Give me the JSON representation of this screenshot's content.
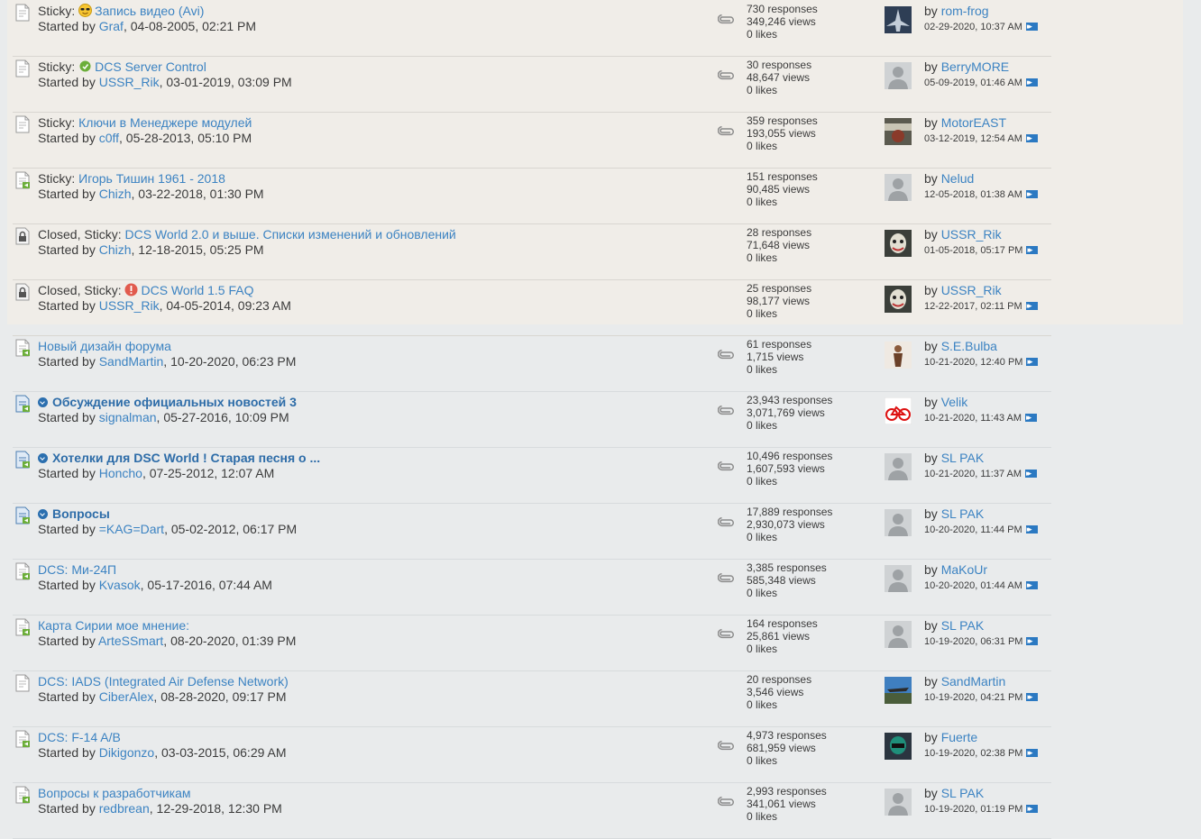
{
  "labels": {
    "started_by": "Started by",
    "by": "by",
    "responses": "responses",
    "views": "views",
    "likes": "likes"
  },
  "topics": [
    {
      "prefix": "Sticky:",
      "emoji": "cool",
      "title": "Запись видео (Avi)",
      "bold": false,
      "author": "Graf",
      "started": "04-08-2005, 02:21 PM",
      "responses": "730",
      "views": "349,246",
      "likes": "0",
      "attach": true,
      "last_user": "rom-frog",
      "last_date": "02-29-2020, 10:37 AM",
      "avatar": "jet",
      "icon": "doc"
    },
    {
      "prefix": "Sticky:",
      "emoji": "green",
      "title": "DCS Server Control",
      "bold": false,
      "author": "USSR_Rik",
      "started": "03-01-2019, 03:09 PM",
      "responses": "30",
      "views": "48,647",
      "likes": "0",
      "attach": true,
      "last_user": "BerryMORE",
      "last_date": "05-09-2019, 01:46 AM",
      "avatar": "default",
      "icon": "doc"
    },
    {
      "prefix": "Sticky:",
      "emoji": "",
      "title": "Ключи в Менеджере модулей",
      "bold": false,
      "author": "c0ff",
      "started": "05-28-2013, 05:10 PM",
      "responses": "359",
      "views": "193,055",
      "likes": "0",
      "attach": true,
      "last_user": "MotorEAST",
      "last_date": "03-12-2019, 12:54 AM",
      "avatar": "photo",
      "icon": "doc"
    },
    {
      "prefix": "Sticky:",
      "emoji": "",
      "title": "Игорь Тишин 1961 - 2018",
      "bold": false,
      "author": "Chizh",
      "started": "03-22-2018, 01:30 PM",
      "responses": "151",
      "views": "90,485",
      "likes": "0",
      "attach": false,
      "last_user": "Nelud",
      "last_date": "12-05-2018, 01:38 AM",
      "avatar": "default",
      "icon": "doc-new"
    },
    {
      "prefix": "Closed, Sticky:",
      "emoji": "",
      "title": "DCS World 2.0 и выше. Списки изменений и обновлений",
      "bold": false,
      "author": "Chizh",
      "started": "12-18-2015, 05:25 PM",
      "responses": "28",
      "views": "71,648",
      "likes": "0",
      "attach": false,
      "last_user": "USSR_Rik",
      "last_date": "01-05-2018, 05:17 PM",
      "avatar": "joker",
      "icon": "lock"
    },
    {
      "prefix": "Closed, Sticky:",
      "emoji": "red",
      "title": "DCS World 1.5 FAQ",
      "bold": false,
      "author": "USSR_Rik",
      "started": "04-05-2014, 09:23 AM",
      "responses": "25",
      "views": "98,177",
      "likes": "0",
      "attach": false,
      "last_user": "USSR_Rik",
      "last_date": "12-22-2017, 02:11 PM",
      "avatar": "joker",
      "icon": "lock"
    },
    {
      "prefix": "",
      "emoji": "",
      "title": "Новый дизайн форума",
      "bold": false,
      "author": "SandMartin",
      "started": "10-20-2020, 06:23 PM",
      "responses": "61",
      "views": "1,715",
      "likes": "0",
      "attach": true,
      "last_user": "S.E.Bulba",
      "last_date": "10-21-2020, 12:40 PM",
      "avatar": "figure",
      "icon": "doc-new"
    },
    {
      "prefix": "",
      "emoji": "",
      "title": "Обсуждение официальных новостей 3",
      "bold": true,
      "author": "signalman",
      "started": "05-27-2016, 10:09 PM",
      "responses": "23,943",
      "views": "3,071,769",
      "likes": "0",
      "attach": true,
      "last_user": "Velik",
      "last_date": "10-21-2020, 11:43 AM",
      "avatar": "bike",
      "icon": "doc-hot"
    },
    {
      "prefix": "",
      "emoji": "",
      "title": "Хотелки для DSC World ! Старая песня о ...",
      "bold": true,
      "author": "Honcho",
      "started": "07-25-2012, 12:07 AM",
      "responses": "10,496",
      "views": "1,607,593",
      "likes": "0",
      "attach": true,
      "last_user": "SL PAK",
      "last_date": "10-21-2020, 11:37 AM",
      "avatar": "default",
      "icon": "doc-hot"
    },
    {
      "prefix": "",
      "emoji": "",
      "title": "Вопросы",
      "bold": true,
      "author": "=KAG=Dart",
      "started": "05-02-2012, 06:17 PM",
      "responses": "17,889",
      "views": "2,930,073",
      "likes": "0",
      "attach": true,
      "last_user": "SL PAK",
      "last_date": "10-20-2020, 11:44 PM",
      "avatar": "default",
      "icon": "doc-hot"
    },
    {
      "prefix": "",
      "emoji": "",
      "title": "DCS: Ми-24П",
      "bold": false,
      "author": "Kvasok",
      "started": "05-17-2016, 07:44 AM",
      "responses": "3,385",
      "views": "585,348",
      "likes": "0",
      "attach": true,
      "last_user": "MaKoUr",
      "last_date": "10-20-2020, 01:44 AM",
      "avatar": "default",
      "icon": "doc-new"
    },
    {
      "prefix": "",
      "emoji": "",
      "title": "Карта Сирии мое мнение:",
      "bold": false,
      "author": "ArteSSmart",
      "started": "08-20-2020, 01:39 PM",
      "responses": "164",
      "views": "25,861",
      "likes": "0",
      "attach": true,
      "last_user": "SL PAK",
      "last_date": "10-19-2020, 06:31 PM",
      "avatar": "default",
      "icon": "doc-new"
    },
    {
      "prefix": "",
      "emoji": "",
      "title": "DCS: IADS (Integrated Air Defense Network)",
      "bold": false,
      "author": "CiberAlex",
      "started": "08-28-2020, 09:17 PM",
      "responses": "20",
      "views": "3,546",
      "likes": "0",
      "attach": false,
      "last_user": "SandMartin",
      "last_date": "10-19-2020, 04:21 PM",
      "avatar": "jet2",
      "icon": "doc"
    },
    {
      "prefix": "",
      "emoji": "",
      "title": "DCS: F-14 A/B",
      "bold": false,
      "author": "Dikigonzo",
      "started": "03-03-2015, 06:29 AM",
      "responses": "4,973",
      "views": "681,959",
      "likes": "0",
      "attach": true,
      "last_user": "Fuerte",
      "last_date": "10-19-2020, 02:38 PM",
      "avatar": "pilot",
      "icon": "doc-new"
    },
    {
      "prefix": "",
      "emoji": "",
      "title": "Вопросы к разработчикам",
      "bold": false,
      "author": "redbrean",
      "started": "12-29-2018, 12:30 PM",
      "responses": "2,993",
      "views": "341,061",
      "likes": "0",
      "attach": true,
      "last_user": "SL PAK",
      "last_date": "10-19-2020, 01:19 PM",
      "avatar": "default",
      "icon": "doc-new"
    }
  ],
  "colors": {
    "link": "#3c83c2",
    "sticky_bg": "#f0ede8",
    "page_bg": "#e9ebec",
    "accent": "#2b79c2"
  }
}
